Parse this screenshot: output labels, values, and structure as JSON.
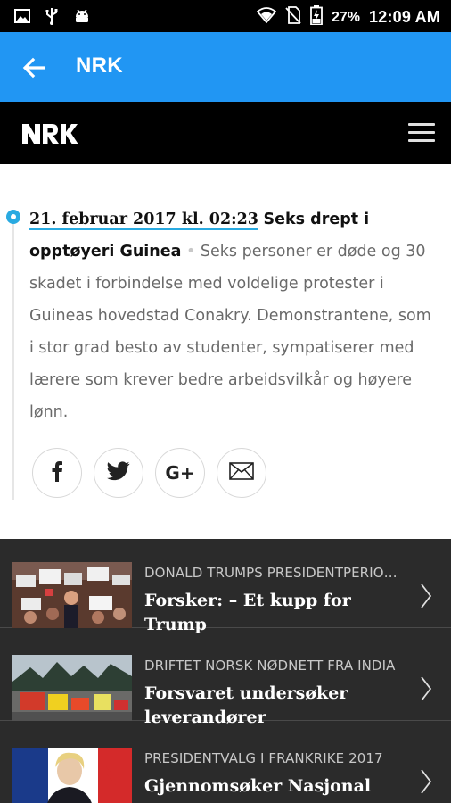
{
  "status": {
    "battery_pct": "27%",
    "time": "12:09 AM",
    "icons": [
      "image-icon",
      "usb-icon",
      "android-icon",
      "wifi-icon",
      "no-sim-icon",
      "battery-icon"
    ]
  },
  "appbar": {
    "title": "NRK",
    "back_icon": "arrow-back-icon"
  },
  "nrkbar": {
    "logo": "NRK",
    "menu_icon": "hamburger-menu-icon"
  },
  "article": {
    "date": "21. februar 2017 kl. 02:23",
    "headline": "Seks drept i opptøyeri Guinea",
    "separator": "•",
    "body": "Seks personer er døde og 30 skadet i forbindelse med voldelige protester i Guineas hovedstad Conakry. Demonstrantene, som i stor grad besto av studenter, sympatiserer med lærere som krever bedre arbeidsvilkår og høyere lønn.",
    "share_buttons": [
      "facebook-icon",
      "twitter-icon",
      "google-plus-icon",
      "email-icon"
    ],
    "gplus_label": "G+"
  },
  "accent_color": "#2196f3",
  "timeline_color": "#29aae1",
  "related": [
    {
      "kicker": "DONALD TRUMPS PRESIDENTPERIO…",
      "title": "Forsker: – Et kupp for Trump"
    },
    {
      "kicker": "DRIFTET NORSK NØDNETT FRA INDIA",
      "title": "Forsvaret undersøker leverandører"
    },
    {
      "kicker": "PRESIDENTVALG I FRANKRIKE 2017",
      "title": "Gjennomsøker Nasjonal Front-"
    }
  ]
}
